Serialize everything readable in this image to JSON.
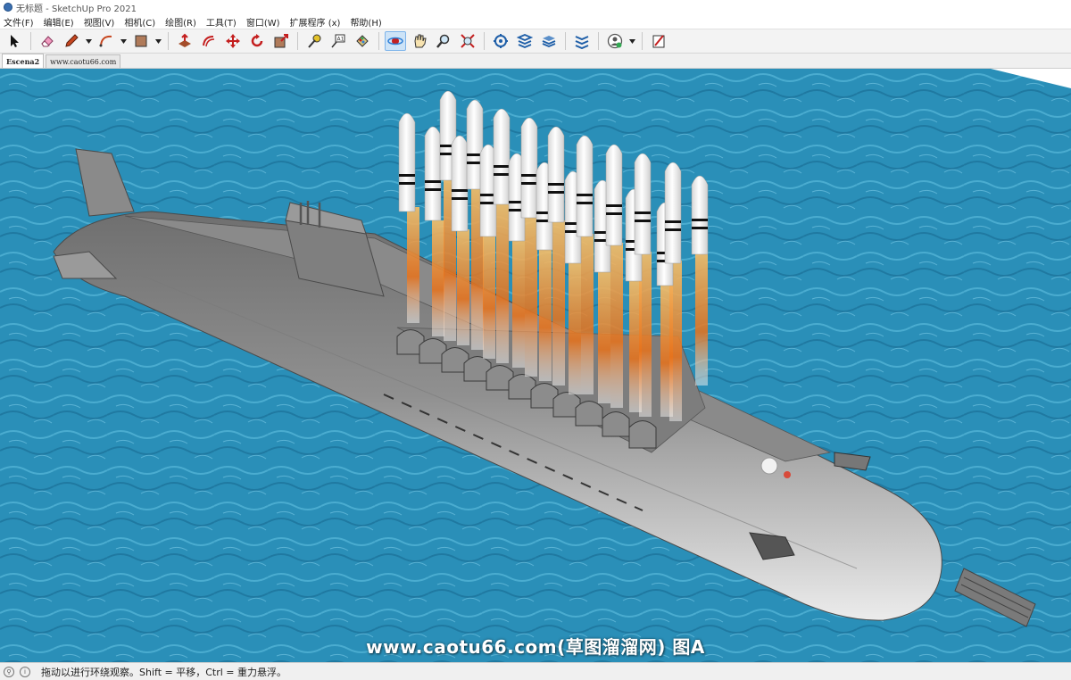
{
  "window": {
    "title": "无标题 - SketchUp Pro 2021"
  },
  "menu": [
    {
      "label": "文件(F)"
    },
    {
      "label": "编辑(E)"
    },
    {
      "label": "视图(V)"
    },
    {
      "label": "相机(C)"
    },
    {
      "label": "绘图(R)"
    },
    {
      "label": "工具(T)"
    },
    {
      "label": "窗口(W)"
    },
    {
      "label": "扩展程序 (x)"
    },
    {
      "label": "帮助(H)"
    }
  ],
  "toolbar": {
    "tools": [
      {
        "name": "select",
        "icon": "arrow-cursor-icon"
      },
      {
        "name": "eraser",
        "icon": "eraser-icon"
      },
      {
        "name": "pencil",
        "icon": "pencil-icon",
        "dropdown": true
      },
      {
        "name": "arc",
        "icon": "arc-icon",
        "dropdown": true
      },
      {
        "name": "rectangle",
        "icon": "rectangle-icon",
        "dropdown": true
      },
      {
        "name": "push-pull",
        "icon": "push-pull-icon"
      },
      {
        "name": "offset",
        "icon": "offset-icon"
      },
      {
        "name": "move",
        "icon": "move-icon"
      },
      {
        "name": "rotate",
        "icon": "rotate-icon"
      },
      {
        "name": "scale",
        "icon": "scale-icon"
      },
      {
        "name": "tape-measure",
        "icon": "tape-measure-icon"
      },
      {
        "name": "text",
        "icon": "text-icon"
      },
      {
        "name": "paint-bucket",
        "icon": "paint-bucket-icon"
      },
      {
        "name": "orbit",
        "icon": "orbit-icon",
        "active": true
      },
      {
        "name": "pan",
        "icon": "pan-hand-icon"
      },
      {
        "name": "zoom",
        "icon": "zoom-icon"
      },
      {
        "name": "zoom-extents",
        "icon": "zoom-extents-icon"
      },
      {
        "name": "warehouse",
        "icon": "warehouse-icon"
      },
      {
        "name": "extension-warehouse",
        "icon": "extension-warehouse-icon"
      },
      {
        "name": "layers",
        "icon": "layers-icon"
      },
      {
        "name": "trimble-connect",
        "icon": "trimble-connect-icon"
      },
      {
        "name": "account",
        "icon": "account-icon",
        "dropdown": true
      },
      {
        "name": "layout",
        "icon": "layout-icon"
      }
    ]
  },
  "scenes": [
    {
      "label": "Escena2"
    },
    {
      "label": "www.caotu66.com",
      "current": true
    }
  ],
  "viewport": {
    "watermark": "www.caotu66.com(草图溜溜网) 图A",
    "colors": {
      "sea": "#2a8fb8",
      "hull": "#8c8c8c",
      "flame": "#e8721a"
    }
  },
  "status": {
    "text": "拖动以进行环绕观察。Shift = 平移，Ctrl = 重力悬浮。"
  }
}
